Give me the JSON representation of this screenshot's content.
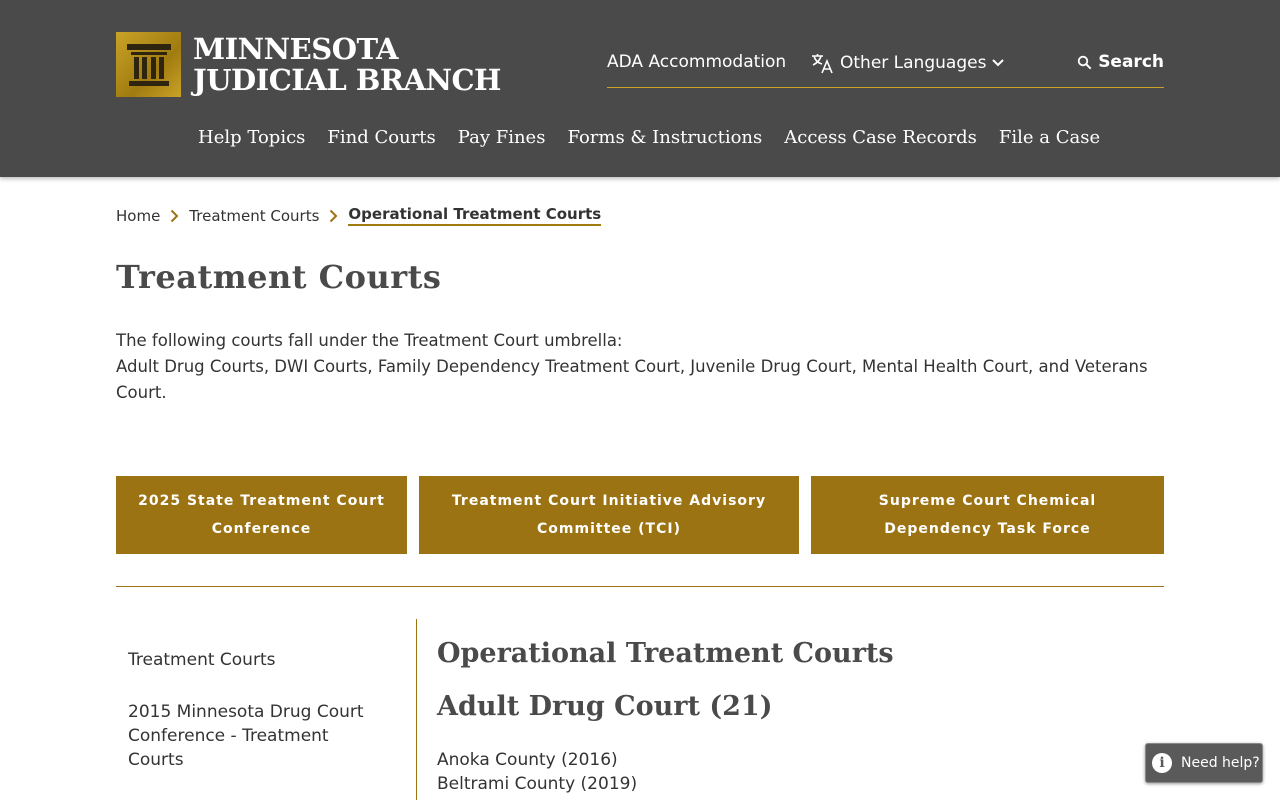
{
  "header": {
    "logo_line1": "MINNESOTA",
    "logo_line2": "JUDICIAL BRANCH",
    "ada": "ADA Accommodation",
    "languages": "Other Languages",
    "search": "Search",
    "nav": [
      "Help Topics",
      "Find Courts",
      "Pay Fines",
      "Forms & Instructions",
      "Access Case Records",
      "File a Case"
    ]
  },
  "breadcrumb": {
    "home": "Home",
    "parent": "Treatment Courts",
    "current": "Operational Treatment Courts"
  },
  "page": {
    "title": "Treatment Courts",
    "intro_line1": "The following courts fall under the Treatment Court umbrella:",
    "intro_line2": "Adult Drug Courts, DWI Courts, Family Dependency Treatment Court, Juvenile Drug Court, Mental Health Court, and Veterans Court."
  },
  "buttons": [
    {
      "label": "2025 State Treatment Court Conference"
    },
    {
      "label": "Treatment Court Initiative Advisory Committee (TCI)"
    },
    {
      "label": "Supreme Court Chemical Dependency Task Force"
    }
  ],
  "sidenav": [
    {
      "label": "Treatment Courts"
    },
    {
      "label": "2015 Minnesota Drug Court Conference - Treatment Courts"
    }
  ],
  "content": {
    "heading": "Operational Treatment Courts",
    "subheading": "Adult Drug Court (21)",
    "counties": [
      "Anoka County (2016)",
      "Beltrami County (2019)"
    ]
  },
  "help": {
    "label": "Need help?"
  },
  "colors": {
    "header_bg": "#4a4a4a",
    "accent": "#9c7312",
    "gold": "#c9a227"
  },
  "icons": {
    "logo": "courthouse-pillar-icon",
    "lang": "translate-icon",
    "search": "search-icon",
    "chevron": "chevron-down-icon",
    "breadcrumb_sep": "chevron-right-icon",
    "help": "info-icon"
  }
}
